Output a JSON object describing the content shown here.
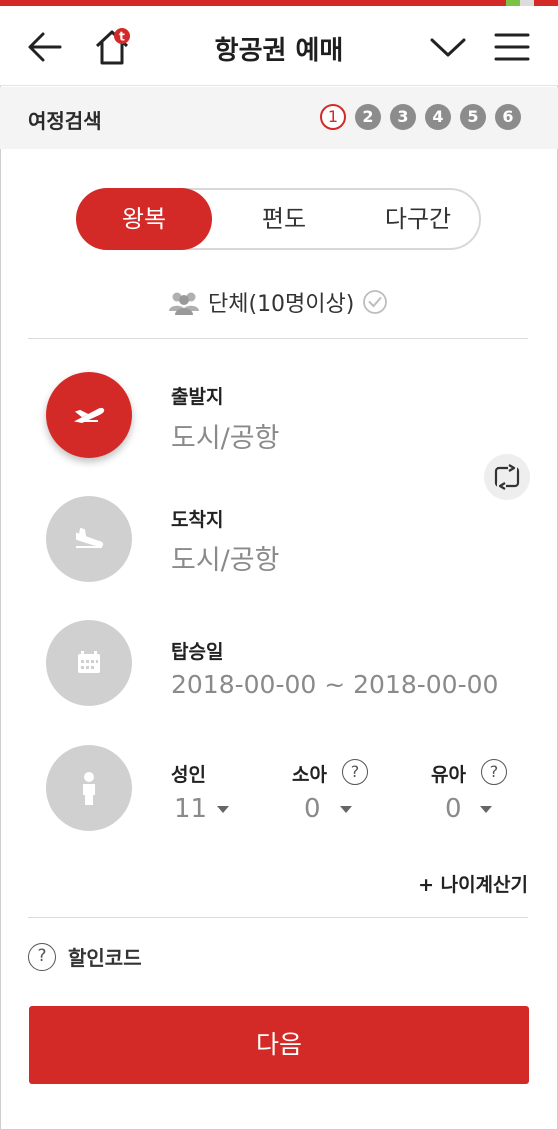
{
  "header": {
    "title": "항공권 예매",
    "icons": [
      "back-arrow-icon",
      "home-icon",
      "chevron-down-icon",
      "hamburger-menu-icon"
    ],
    "home_badge": "t"
  },
  "steps": {
    "label": "여정검색",
    "items": [
      "1",
      "2",
      "3",
      "4",
      "5",
      "6"
    ],
    "active": "1"
  },
  "trip_type": {
    "tabs": [
      "왕복",
      "편도",
      "다구간"
    ],
    "selected": "왕복"
  },
  "group": {
    "label": "단체(10명이상)"
  },
  "departure": {
    "label": "출발지",
    "placeholder": "도시/공항"
  },
  "arrival": {
    "label": "도착지",
    "placeholder": "도시/공항"
  },
  "date": {
    "label": "탑승일",
    "value": "2018-00-00 ~ 2018-00-00"
  },
  "passengers": {
    "adult": {
      "label": "성인",
      "value": "11"
    },
    "child": {
      "label": "소아",
      "value": "0",
      "help": "?"
    },
    "infant": {
      "label": "유아",
      "value": "0",
      "help": "?"
    }
  },
  "age_calc": {
    "label": "+ 나이계산기"
  },
  "discount": {
    "label": "할인코드",
    "help": "?"
  },
  "next_button": {
    "label": "다음"
  },
  "colors": {
    "accent": "#d42a27",
    "inactive": "#d0d0d0",
    "muted_text": "#8a8a8a"
  }
}
